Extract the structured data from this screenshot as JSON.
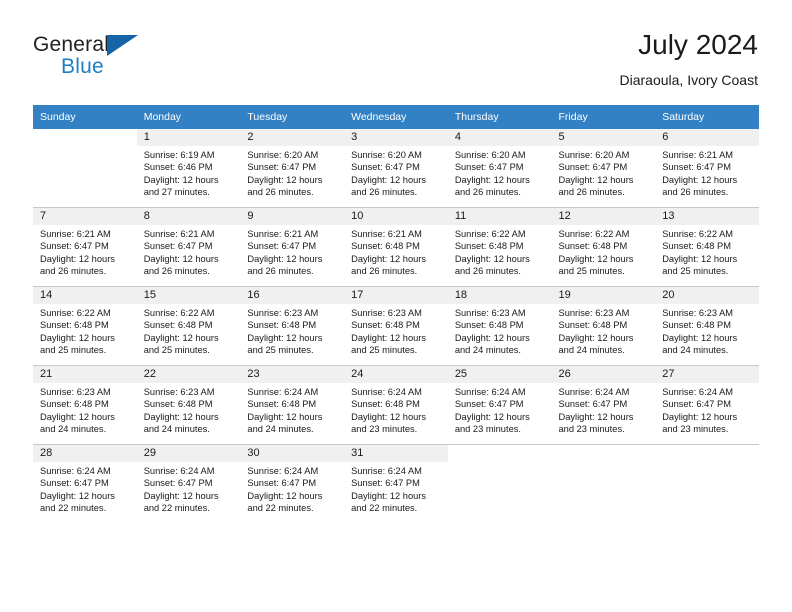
{
  "brand": {
    "name_part1": "General",
    "name_part2": "Blue",
    "logo_icon": "triangle-icon"
  },
  "header": {
    "title": "July 2024",
    "subtitle": "Diaraoula, Ivory Coast"
  },
  "colors": {
    "header_bar": "#3281c4",
    "brand_blue": "#1f7fc4",
    "day_number_shade": "#f0f0f0",
    "row_divider": "#c8c8c8"
  },
  "weekday_headers": [
    "Sunday",
    "Monday",
    "Tuesday",
    "Wednesday",
    "Thursday",
    "Friday",
    "Saturday"
  ],
  "labels": {
    "sunrise_prefix": "Sunrise:",
    "sunset_prefix": "Sunset:",
    "daylight_prefix": "Daylight:"
  },
  "weeks": [
    [
      {
        "day": "",
        "empty": true
      },
      {
        "day": "1",
        "sunrise": "Sunrise: 6:19 AM",
        "sunset": "Sunset: 6:46 PM",
        "daylight1": "Daylight: 12 hours",
        "daylight2": "and 27 minutes."
      },
      {
        "day": "2",
        "sunrise": "Sunrise: 6:20 AM",
        "sunset": "Sunset: 6:47 PM",
        "daylight1": "Daylight: 12 hours",
        "daylight2": "and 26 minutes."
      },
      {
        "day": "3",
        "sunrise": "Sunrise: 6:20 AM",
        "sunset": "Sunset: 6:47 PM",
        "daylight1": "Daylight: 12 hours",
        "daylight2": "and 26 minutes."
      },
      {
        "day": "4",
        "sunrise": "Sunrise: 6:20 AM",
        "sunset": "Sunset: 6:47 PM",
        "daylight1": "Daylight: 12 hours",
        "daylight2": "and 26 minutes."
      },
      {
        "day": "5",
        "sunrise": "Sunrise: 6:20 AM",
        "sunset": "Sunset: 6:47 PM",
        "daylight1": "Daylight: 12 hours",
        "daylight2": "and 26 minutes."
      },
      {
        "day": "6",
        "sunrise": "Sunrise: 6:21 AM",
        "sunset": "Sunset: 6:47 PM",
        "daylight1": "Daylight: 12 hours",
        "daylight2": "and 26 minutes."
      }
    ],
    [
      {
        "day": "7",
        "sunrise": "Sunrise: 6:21 AM",
        "sunset": "Sunset: 6:47 PM",
        "daylight1": "Daylight: 12 hours",
        "daylight2": "and 26 minutes."
      },
      {
        "day": "8",
        "sunrise": "Sunrise: 6:21 AM",
        "sunset": "Sunset: 6:47 PM",
        "daylight1": "Daylight: 12 hours",
        "daylight2": "and 26 minutes."
      },
      {
        "day": "9",
        "sunrise": "Sunrise: 6:21 AM",
        "sunset": "Sunset: 6:47 PM",
        "daylight1": "Daylight: 12 hours",
        "daylight2": "and 26 minutes."
      },
      {
        "day": "10",
        "sunrise": "Sunrise: 6:21 AM",
        "sunset": "Sunset: 6:48 PM",
        "daylight1": "Daylight: 12 hours",
        "daylight2": "and 26 minutes."
      },
      {
        "day": "11",
        "sunrise": "Sunrise: 6:22 AM",
        "sunset": "Sunset: 6:48 PM",
        "daylight1": "Daylight: 12 hours",
        "daylight2": "and 26 minutes."
      },
      {
        "day": "12",
        "sunrise": "Sunrise: 6:22 AM",
        "sunset": "Sunset: 6:48 PM",
        "daylight1": "Daylight: 12 hours",
        "daylight2": "and 25 minutes."
      },
      {
        "day": "13",
        "sunrise": "Sunrise: 6:22 AM",
        "sunset": "Sunset: 6:48 PM",
        "daylight1": "Daylight: 12 hours",
        "daylight2": "and 25 minutes."
      }
    ],
    [
      {
        "day": "14",
        "sunrise": "Sunrise: 6:22 AM",
        "sunset": "Sunset: 6:48 PM",
        "daylight1": "Daylight: 12 hours",
        "daylight2": "and 25 minutes."
      },
      {
        "day": "15",
        "sunrise": "Sunrise: 6:22 AM",
        "sunset": "Sunset: 6:48 PM",
        "daylight1": "Daylight: 12 hours",
        "daylight2": "and 25 minutes."
      },
      {
        "day": "16",
        "sunrise": "Sunrise: 6:23 AM",
        "sunset": "Sunset: 6:48 PM",
        "daylight1": "Daylight: 12 hours",
        "daylight2": "and 25 minutes."
      },
      {
        "day": "17",
        "sunrise": "Sunrise: 6:23 AM",
        "sunset": "Sunset: 6:48 PM",
        "daylight1": "Daylight: 12 hours",
        "daylight2": "and 25 minutes."
      },
      {
        "day": "18",
        "sunrise": "Sunrise: 6:23 AM",
        "sunset": "Sunset: 6:48 PM",
        "daylight1": "Daylight: 12 hours",
        "daylight2": "and 24 minutes."
      },
      {
        "day": "19",
        "sunrise": "Sunrise: 6:23 AM",
        "sunset": "Sunset: 6:48 PM",
        "daylight1": "Daylight: 12 hours",
        "daylight2": "and 24 minutes."
      },
      {
        "day": "20",
        "sunrise": "Sunrise: 6:23 AM",
        "sunset": "Sunset: 6:48 PM",
        "daylight1": "Daylight: 12 hours",
        "daylight2": "and 24 minutes."
      }
    ],
    [
      {
        "day": "21",
        "sunrise": "Sunrise: 6:23 AM",
        "sunset": "Sunset: 6:48 PM",
        "daylight1": "Daylight: 12 hours",
        "daylight2": "and 24 minutes."
      },
      {
        "day": "22",
        "sunrise": "Sunrise: 6:23 AM",
        "sunset": "Sunset: 6:48 PM",
        "daylight1": "Daylight: 12 hours",
        "daylight2": "and 24 minutes."
      },
      {
        "day": "23",
        "sunrise": "Sunrise: 6:24 AM",
        "sunset": "Sunset: 6:48 PM",
        "daylight1": "Daylight: 12 hours",
        "daylight2": "and 24 minutes."
      },
      {
        "day": "24",
        "sunrise": "Sunrise: 6:24 AM",
        "sunset": "Sunset: 6:48 PM",
        "daylight1": "Daylight: 12 hours",
        "daylight2": "and 23 minutes."
      },
      {
        "day": "25",
        "sunrise": "Sunrise: 6:24 AM",
        "sunset": "Sunset: 6:47 PM",
        "daylight1": "Daylight: 12 hours",
        "daylight2": "and 23 minutes."
      },
      {
        "day": "26",
        "sunrise": "Sunrise: 6:24 AM",
        "sunset": "Sunset: 6:47 PM",
        "daylight1": "Daylight: 12 hours",
        "daylight2": "and 23 minutes."
      },
      {
        "day": "27",
        "sunrise": "Sunrise: 6:24 AM",
        "sunset": "Sunset: 6:47 PM",
        "daylight1": "Daylight: 12 hours",
        "daylight2": "and 23 minutes."
      }
    ],
    [
      {
        "day": "28",
        "sunrise": "Sunrise: 6:24 AM",
        "sunset": "Sunset: 6:47 PM",
        "daylight1": "Daylight: 12 hours",
        "daylight2": "and 22 minutes."
      },
      {
        "day": "29",
        "sunrise": "Sunrise: 6:24 AM",
        "sunset": "Sunset: 6:47 PM",
        "daylight1": "Daylight: 12 hours",
        "daylight2": "and 22 minutes."
      },
      {
        "day": "30",
        "sunrise": "Sunrise: 6:24 AM",
        "sunset": "Sunset: 6:47 PM",
        "daylight1": "Daylight: 12 hours",
        "daylight2": "and 22 minutes."
      },
      {
        "day": "31",
        "sunrise": "Sunrise: 6:24 AM",
        "sunset": "Sunset: 6:47 PM",
        "daylight1": "Daylight: 12 hours",
        "daylight2": "and 22 minutes."
      },
      {
        "day": "",
        "empty": true
      },
      {
        "day": "",
        "empty": true
      },
      {
        "day": "",
        "empty": true
      }
    ]
  ]
}
